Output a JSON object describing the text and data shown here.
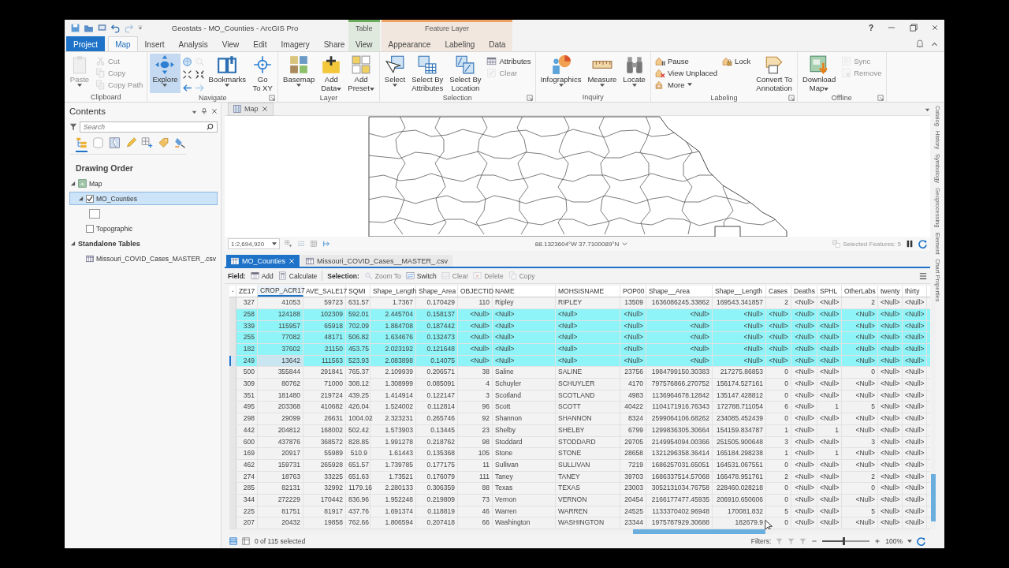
{
  "title_bar": {
    "title": "Geostats - MO_Counties - ArcGIS Pro",
    "help": "?"
  },
  "ribbon_tabs": [
    {
      "label": "Project",
      "kind": "backstage",
      "selected": false
    },
    {
      "label": "Map",
      "kind": "tab",
      "selected": true
    },
    {
      "label": "Insert",
      "kind": "tab",
      "selected": false
    },
    {
      "label": "Analysis",
      "kind": "tab",
      "selected": false
    },
    {
      "label": "View",
      "kind": "tab",
      "selected": false
    },
    {
      "label": "Edit",
      "kind": "tab",
      "selected": false
    },
    {
      "label": "Imagery",
      "kind": "tab",
      "selected": false
    },
    {
      "label": "Share",
      "kind": "tab",
      "selected": false
    }
  ],
  "contextual_groups": [
    {
      "label": "Table",
      "color": "#6aac5c",
      "tabs": [
        {
          "label": "View",
          "selected": false
        }
      ]
    },
    {
      "label": "Feature Layer",
      "color": "#eea060",
      "tabs": [
        {
          "label": "Appearance",
          "selected": false
        },
        {
          "label": "Labeling",
          "selected": false
        },
        {
          "label": "Data",
          "selected": false
        }
      ]
    }
  ],
  "ribbon_groups": [
    {
      "label": "Clipboard",
      "launcher": false,
      "columns": [
        [
          {
            "label": "Paste",
            "kind": "large",
            "disabled": true,
            "selected": false,
            "dropdown": true
          }
        ],
        [
          {
            "label": "Cut",
            "kind": "small",
            "disabled": true,
            "dropdown": false
          },
          {
            "label": "Copy",
            "kind": "small",
            "disabled": true,
            "dropdown": false
          },
          {
            "label": "Copy Path",
            "kind": "small",
            "disabled": true,
            "dropdown": false
          }
        ]
      ]
    },
    {
      "label": "Navigate",
      "launcher": true,
      "columns": [
        [
          {
            "label": "Explore",
            "kind": "large",
            "disabled": false,
            "selected": true,
            "dropdown": true
          }
        ],
        [
          {
            "kind": "icon-grid",
            "buttons": [
              {
                "disabled": false
              },
              {
                "disabled": true
              },
              {
                "disabled": false
              },
              {
                "disabled": false
              },
              {
                "disabled": false
              },
              {
                "disabled": true
              }
            ]
          }
        ],
        [
          {
            "label": "Bookmarks",
            "kind": "large",
            "disabled": false,
            "selected": false,
            "dropdown": true
          }
        ],
        [
          {
            "label": "Go To XY",
            "kind": "large",
            "disabled": false,
            "selected": false,
            "dropdown": false
          }
        ]
      ]
    },
    {
      "label": "Layer",
      "launcher": false,
      "columns": [
        [
          {
            "label": "Basemap",
            "kind": "large",
            "disabled": false,
            "selected": false,
            "dropdown": true
          }
        ],
        [
          {
            "label": "Add Data",
            "kind": "large",
            "disabled": false,
            "selected": false,
            "dropdown": true
          }
        ],
        [
          {
            "label": "Add Preset",
            "kind": "large",
            "disabled": false,
            "selected": false,
            "dropdown": true
          }
        ]
      ]
    },
    {
      "label": "Selection",
      "launcher": true,
      "columns": [
        [
          {
            "label": "Select",
            "kind": "large",
            "disabled": false,
            "selected": false,
            "dropdown": true
          }
        ],
        [
          {
            "label": "Select By Attributes",
            "kind": "large",
            "disabled": false,
            "selected": false,
            "dropdown": false
          }
        ],
        [
          {
            "label": "Select By Location",
            "kind": "large",
            "disabled": false,
            "selected": false,
            "dropdown": false
          }
        ],
        [
          {
            "label": "Attributes",
            "kind": "small",
            "disabled": false,
            "dropdown": false
          },
          {
            "label": "Clear",
            "kind": "small",
            "disabled": true,
            "dropdown": false
          }
        ]
      ]
    },
    {
      "label": "Inquiry",
      "launcher": false,
      "columns": [
        [
          {
            "label": "Infographics",
            "kind": "large",
            "disabled": false,
            "selected": false,
            "dropdown": true
          }
        ],
        [
          {
            "label": "Measure",
            "kind": "large",
            "disabled": false,
            "selected": false,
            "dropdown": true
          }
        ],
        [
          {
            "label": "Locate",
            "kind": "large",
            "disabled": false,
            "selected": false,
            "dropdown": true
          }
        ]
      ]
    },
    {
      "label": "Labeling",
      "launcher": true,
      "columns": [
        [
          {
            "label": "Pause",
            "kind": "small",
            "disabled": false,
            "dropdown": false
          },
          {
            "label": "View Unplaced",
            "kind": "small",
            "disabled": false,
            "dropdown": false
          },
          {
            "label": "More",
            "kind": "small",
            "disabled": false,
            "dropdown": true
          }
        ],
        [
          {
            "label": "Lock",
            "kind": "small",
            "disabled": false,
            "dropdown": false
          }
        ],
        [
          {
            "label": "Convert To Annotation",
            "kind": "large",
            "disabled": false,
            "selected": false,
            "dropdown": false
          }
        ]
      ]
    },
    {
      "label": "Offline",
      "launcher": true,
      "columns": [
        [
          {
            "label": "Download Map",
            "kind": "large",
            "disabled": false,
            "selected": false,
            "dropdown": true
          }
        ],
        [
          {
            "label": "Sync",
            "kind": "small",
            "disabled": true,
            "dropdown": false
          },
          {
            "label": "Remove",
            "kind": "small",
            "disabled": true,
            "dropdown": false
          }
        ]
      ]
    }
  ],
  "contents": {
    "title": "Contents",
    "search": {
      "placeholder": "Search"
    },
    "view_tabs": [
      {
        "selected": true
      },
      {
        "selected": false
      },
      {
        "selected": false
      },
      {
        "selected": false
      },
      {
        "selected": false
      },
      {
        "selected": false
      },
      {
        "selected": false
      }
    ],
    "heading": "Drawing Order",
    "tree": [
      {
        "label": "Map",
        "kind": "map",
        "expanded": true,
        "children": [
          {
            "label": "MO_Counties",
            "kind": "layer",
            "checked": true,
            "selected": true,
            "expanded": true,
            "children": [
              {
                "kind": "symbol"
              }
            ]
          },
          {
            "label": "Topographic",
            "kind": "layer",
            "checked": false,
            "selected": false
          }
        ]
      },
      {
        "label": "Standalone Tables",
        "kind": "group",
        "expanded": true,
        "children": [
          {
            "label": "Missouri_COVID_Cases_MASTER_.csv",
            "kind": "table",
            "selected": false
          }
        ]
      }
    ]
  },
  "map_view": {
    "tab": "Map",
    "scale": "1:2,694,920",
    "coordinates": "88.1323604°W 37.7100089°N",
    "selected_features": "Selected Features: 5"
  },
  "table_view": {
    "tabs": [
      {
        "label": "MO_Counties",
        "selected": true,
        "closable": true
      },
      {
        "label": "Missouri_COVID_Cases__MASTER_.csv",
        "selected": false,
        "closable": false
      }
    ],
    "toolbar": [
      {
        "kind": "label",
        "label": "Field:"
      },
      {
        "kind": "button",
        "label": "Add",
        "disabled": false
      },
      {
        "kind": "button",
        "label": "Calculate",
        "disabled": false
      },
      {
        "kind": "label",
        "label": "Selection:"
      },
      {
        "kind": "button",
        "label": "Zoom To",
        "disabled": true
      },
      {
        "kind": "button",
        "label": "Switch",
        "disabled": false
      },
      {
        "kind": "button",
        "label": "Clear",
        "disabled": true
      },
      {
        "kind": "button",
        "label": "Delete",
        "disabled": true
      },
      {
        "kind": "button",
        "label": "Copy",
        "disabled": true
      }
    ],
    "columns": [
      {
        "label": "ZE17",
        "selected": false
      },
      {
        "label": "CROP_ACR17",
        "selected": true
      },
      {
        "label": "AVE_SALE17",
        "selected": false
      },
      {
        "label": "SQMI",
        "selected": false
      },
      {
        "label": "Shape_Length",
        "selected": false
      },
      {
        "label": "Shape_Area",
        "selected": false
      },
      {
        "label": "OBJECTID",
        "selected": false
      },
      {
        "label": "NAME",
        "selected": false
      },
      {
        "label": "MOHSISNAME",
        "selected": false
      },
      {
        "label": "POP00",
        "selected": false
      },
      {
        "label": "Shape__Area",
        "selected": false
      },
      {
        "label": "Shape__Length",
        "selected": false
      },
      {
        "label": "Cases",
        "selected": false
      },
      {
        "label": "Deaths",
        "selected": false
      },
      {
        "label": "SPHL",
        "selected": false
      },
      {
        "label": "OtherLabs",
        "selected": false
      },
      {
        "label": "twenty",
        "selected": false
      },
      {
        "label": "thirty",
        "selected": false
      }
    ],
    "rows": [
      {
        "selected": false,
        "current": false,
        "cells": [
          "327",
          "41053",
          "59723",
          "631.57",
          "1.7367",
          "0.170429",
          "110",
          "Ripley",
          "RIPLEY",
          "13509",
          "1636086245.33862",
          "169543.341857",
          "2",
          "<Null>",
          "<Null>",
          "2",
          "<Null>",
          "<Null>"
        ]
      },
      {
        "selected": true,
        "current": false,
        "cells": [
          "258",
          "124188",
          "102309",
          "592.01",
          "2.445704",
          "0.158137",
          "<Null>",
          "<Null>",
          "<Null>",
          "<Null>",
          "<Null>",
          "<Null>",
          "<Null>",
          "<Null>",
          "<Null>",
          "<Null>",
          "<Null>",
          "<Null>"
        ]
      },
      {
        "selected": true,
        "current": false,
        "cells": [
          "339",
          "115957",
          "65918",
          "702.09",
          "1.884708",
          "0.187442",
          "<Null>",
          "<Null>",
          "<Null>",
          "<Null>",
          "<Null>",
          "<Null>",
          "<Null>",
          "<Null>",
          "<Null>",
          "<Null>",
          "<Null>",
          "<Null>"
        ]
      },
      {
        "selected": true,
        "current": false,
        "cells": [
          "255",
          "77082",
          "48171",
          "506.82",
          "1.634676",
          "0.132473",
          "<Null>",
          "<Null>",
          "<Null>",
          "<Null>",
          "<Null>",
          "<Null>",
          "<Null>",
          "<Null>",
          "<Null>",
          "<Null>",
          "<Null>",
          "<Null>"
        ]
      },
      {
        "selected": true,
        "current": false,
        "cells": [
          "182",
          "37602",
          "21150",
          "453.75",
          "2.023192",
          "0.121648",
          "<Null>",
          "<Null>",
          "<Null>",
          "<Null>",
          "<Null>",
          "<Null>",
          "<Null>",
          "<Null>",
          "<Null>",
          "<Null>",
          "<Null>",
          "<Null>"
        ]
      },
      {
        "selected": true,
        "current": true,
        "cells": [
          "249",
          "13642",
          "111563",
          "523.93",
          "2.083898",
          "0.14075",
          "<Null>",
          "<Null>",
          "<Null>",
          "<Null>",
          "<Null>",
          "<Null>",
          "<Null>",
          "<Null>",
          "<Null>",
          "<Null>",
          "<Null>",
          "<Null>"
        ]
      },
      {
        "selected": false,
        "current": false,
        "cells": [
          "500",
          "355844",
          "291841",
          "765.37",
          "2.109939",
          "0.206571",
          "38",
          "Saline",
          "SALINE",
          "23756",
          "1984799150.30383",
          "217275.86853",
          "0",
          "<Null>",
          "<Null>",
          "0",
          "<Null>",
          "<Null>"
        ]
      },
      {
        "selected": false,
        "current": false,
        "cells": [
          "309",
          "80762",
          "71000",
          "308.12",
          "1.308999",
          "0.085091",
          "4",
          "Schuyler",
          "SCHUYLER",
          "4170",
          "797576866.270752",
          "156174.527161",
          "0",
          "<Null>",
          "<Null>",
          "<Null>",
          "<Null>",
          "<Null>"
        ]
      },
      {
        "selected": false,
        "current": false,
        "cells": [
          "351",
          "181480",
          "219724",
          "439.25",
          "1.414914",
          "0.122147",
          "3",
          "Scotland",
          "SCOTLAND",
          "4983",
          "1136964678.12842",
          "135147.428812",
          "0",
          "<Null>",
          "<Null>",
          "<Null>",
          "<Null>",
          "<Null>"
        ]
      },
      {
        "selected": false,
        "current": false,
        "cells": [
          "495",
          "203368",
          "410682",
          "426.04",
          "1.524002",
          "0.112814",
          "96",
          "Scott",
          "SCOTT",
          "40422",
          "1104171916.76343",
          "172788.711054",
          "6",
          "<Null>",
          "1",
          "5",
          "<Null>",
          "<Null>"
        ]
      },
      {
        "selected": false,
        "current": false,
        "cells": [
          "298",
          "29099",
          "26631",
          "1004.02",
          "2.323231",
          "0.265746",
          "92",
          "Shannon",
          "SHANNON",
          "8324",
          "2599064106.68262",
          "234085.452439",
          "0",
          "<Null>",
          "<Null>",
          "<Null>",
          "<Null>",
          "<Null>"
        ]
      },
      {
        "selected": false,
        "current": false,
        "cells": [
          "442",
          "204812",
          "168002",
          "502.42",
          "1.573903",
          "0.13445",
          "23",
          "Shelby",
          "SHELBY",
          "6799",
          "1299836305.30664",
          "154159.834787",
          "1",
          "<Null>",
          "1",
          "<Null>",
          "<Null>",
          "<Null>"
        ]
      },
      {
        "selected": false,
        "current": false,
        "cells": [
          "600",
          "437876",
          "368572",
          "828.85",
          "1.991278",
          "0.218762",
          "98",
          "Stoddard",
          "STODDARD",
          "29705",
          "2149954094.00366",
          "251505.900648",
          "3",
          "<Null>",
          "<Null>",
          "3",
          "<Null>",
          "<Null>"
        ]
      },
      {
        "selected": false,
        "current": false,
        "cells": [
          "169",
          "20917",
          "55989",
          "510.9",
          "1.61443",
          "0.135368",
          "105",
          "Stone",
          "STONE",
          "28658",
          "1321296358.36414",
          "165184.298238",
          "1",
          "<Null>",
          "1",
          "<Null>",
          "<Null>",
          "<Null>"
        ]
      },
      {
        "selected": false,
        "current": false,
        "cells": [
          "462",
          "159731",
          "265928",
          "651.57",
          "1.739785",
          "0.177175",
          "11",
          "Sullivan",
          "SULLIVAN",
          "7219",
          "1686257031.65051",
          "164531.067551",
          "0",
          "<Null>",
          "<Null>",
          "<Null>",
          "<Null>",
          "<Null>"
        ]
      },
      {
        "selected": false,
        "current": false,
        "cells": [
          "274",
          "18763",
          "33225",
          "651.63",
          "1.73521",
          "0.176079",
          "111",
          "Taney",
          "TANEY",
          "39703",
          "1686337514.57068",
          "166478.951761",
          "2",
          "<Null>",
          "<Null>",
          "2",
          "<Null>",
          "<Null>"
        ]
      },
      {
        "selected": false,
        "current": false,
        "cells": [
          "285",
          "82131",
          "32992",
          "1179.16",
          "2.280133",
          "0.306359",
          "88",
          "Texas",
          "TEXAS",
          "23003",
          "3052131034.76758",
          "228460.028218",
          "0",
          "<Null>",
          "<Null>",
          "0",
          "<Null>",
          "<Null>"
        ]
      },
      {
        "selected": false,
        "current": false,
        "cells": [
          "344",
          "272229",
          "170442",
          "836.96",
          "1.952248",
          "0.219809",
          "73",
          "Vernon",
          "VERNON",
          "20454",
          "2166177477.45935",
          "206910.650606",
          "0",
          "<Null>",
          "<Null>",
          "<Null>",
          "<Null>",
          "<Null>"
        ]
      },
      {
        "selected": false,
        "current": false,
        "cells": [
          "225",
          "81751",
          "81917",
          "437.76",
          "1.691374",
          "0.118819",
          "46",
          "Warren",
          "WARREN",
          "24525",
          "1133370402.96948",
          "170081.832",
          "5",
          "<Null>",
          "<Null>",
          "5",
          "<Null>",
          "<Null>"
        ]
      },
      {
        "selected": false,
        "current": false,
        "cells": [
          "207",
          "20432",
          "19858",
          "762.66",
          "1.806594",
          "0.207418",
          "66",
          "Washington",
          "WASHINGTON",
          "23344",
          "1975787929.30688",
          "182679.9",
          "0",
          "<Null>",
          "<Null>",
          "<Null>",
          "<Null>",
          "<Null>"
        ]
      }
    ],
    "footer": {
      "status": "0 of 115 selected",
      "filters_label": "Filters:",
      "zoom_slider": {
        "level": 0.45
      },
      "zoom_value": "100%"
    }
  },
  "side_tabs": [
    "Catalog",
    "History",
    "Symbology",
    "Geoprocessing",
    "Element",
    "Chart Properties"
  ]
}
